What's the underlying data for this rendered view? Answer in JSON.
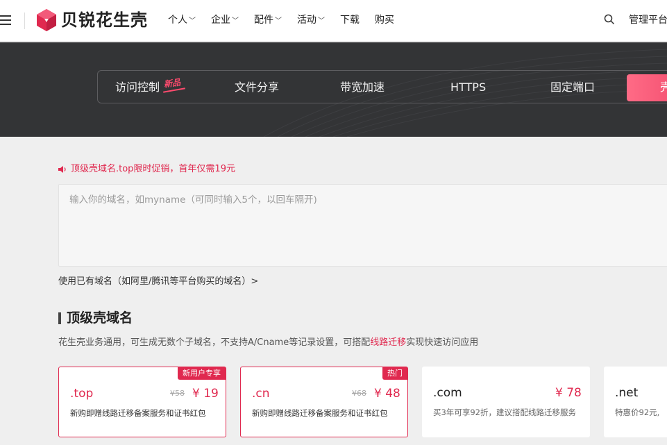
{
  "header": {
    "logo_text": "贝锐花生壳",
    "nav": [
      {
        "label": "个人",
        "has_dropdown": true
      },
      {
        "label": "企业",
        "has_dropdown": true
      },
      {
        "label": "配件",
        "has_dropdown": true
      },
      {
        "label": "活动",
        "has_dropdown": true
      },
      {
        "label": "下载",
        "has_dropdown": false
      },
      {
        "label": "购买",
        "has_dropdown": false
      }
    ],
    "chevron": "﹀",
    "management_label": "管理平台"
  },
  "banner": {
    "tabs": [
      {
        "label": "访问控制"
      },
      {
        "label": "文件分享"
      },
      {
        "label": "带宽加速"
      },
      {
        "label": "HTTPS"
      },
      {
        "label": "固定端口"
      }
    ],
    "new_tag": "新品",
    "active_tab_label": "壳"
  },
  "promo": {
    "text": "顶级壳域名.top限时促销，首年仅需19元",
    "icon": "speaker-icon"
  },
  "domain_input": {
    "placeholder": "输入你的域名，如myname（可同时输入5个，以回车隔开)",
    "value": ""
  },
  "existing_domain_link": "使用已有域名（如阿里/腾讯等平台购买的域名）>",
  "section": {
    "title": "顶级壳域名",
    "desc_prefix": "花生壳业务通用，可生成无数个子域名，不支持A/Cname等记录设置，可搭配",
    "desc_link": "线路迁移",
    "desc_suffix": "实现快速访问应用"
  },
  "cards": [
    {
      "ext": ".top",
      "old_price": "¥58",
      "price": "¥ 19",
      "desc": "新购即赠线路迁移备案服务和证书红包",
      "badge": "新用户专享"
    },
    {
      "ext": ".cn",
      "old_price": "¥68",
      "price": "¥ 48",
      "desc": "新购即赠线路迁移备案服务和证书红包",
      "badge": "热门"
    },
    {
      "ext": ".com",
      "price": "¥ 78",
      "desc": "买3年可享92折，建议搭配线路迁移服务"
    },
    {
      "ext": ".net",
      "desc": "特惠价92元,"
    }
  ],
  "colors": {
    "accent": "#e0294f",
    "banner_bg": "#333436",
    "page_bg": "#efefef"
  }
}
